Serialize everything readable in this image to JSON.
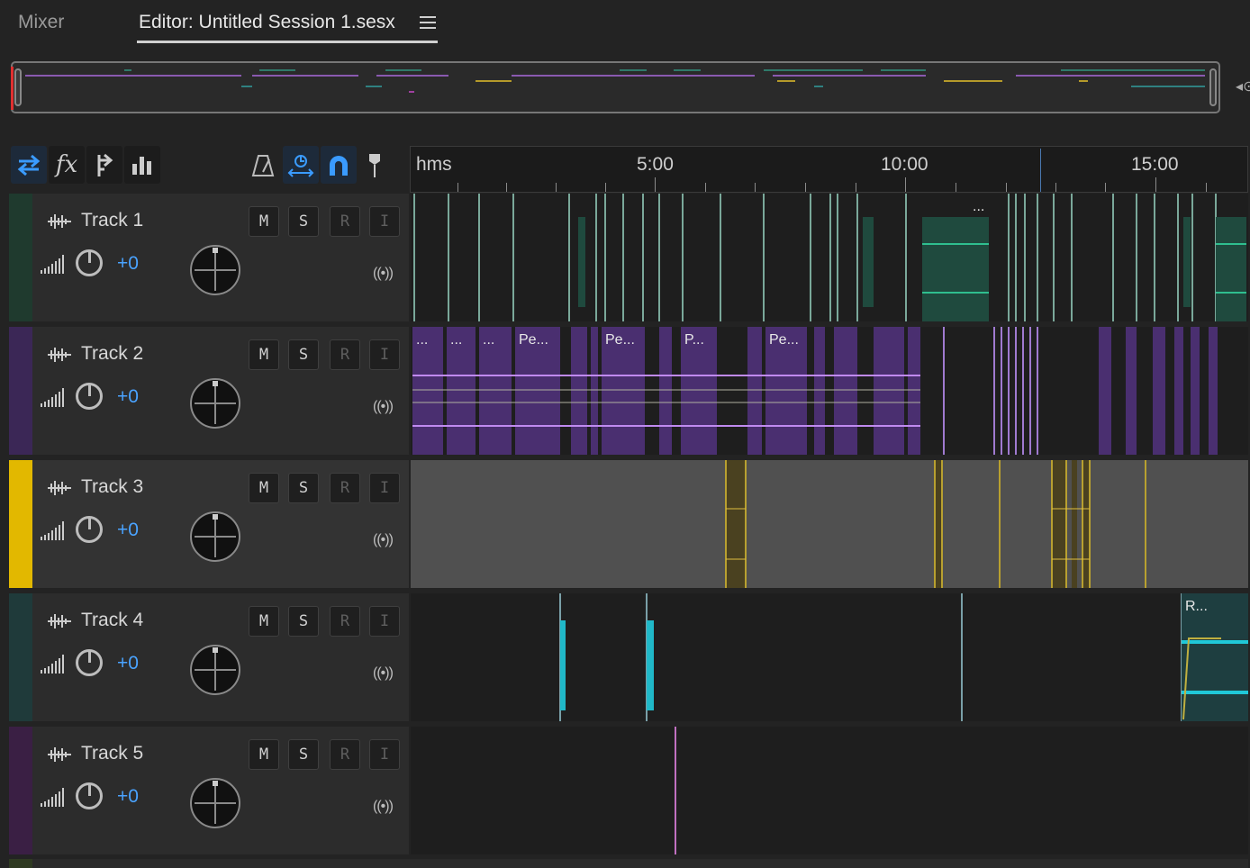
{
  "tabs": {
    "mixer": "Mixer",
    "editor": "Editor: Untitled Session 1.sesx"
  },
  "ruler": {
    "format": "hms",
    "labels": [
      "5:00",
      "10:00",
      "15:00"
    ]
  },
  "colors": {
    "accent": "#4aa3ff",
    "track1": "#1f3a2e",
    "track2": "#3b2756",
    "track3": "#e2b800",
    "track4": "#1f3a3a",
    "track5": "#3a1f44"
  },
  "toolbar": {
    "icons": [
      "switch-icon",
      "fx-icon",
      "sends-icon",
      "eq-icon",
      "metronome-icon",
      "time-select-icon",
      "snap-icon",
      "marker-icon"
    ]
  },
  "tracks": [
    {
      "name": "Track 1",
      "volume": "+0",
      "m": "M",
      "s": "S",
      "r": "R",
      "i": "I",
      "monitor": "((•))"
    },
    {
      "name": "Track 2",
      "volume": "+0",
      "m": "M",
      "s": "S",
      "r": "R",
      "i": "I",
      "monitor": "((•))"
    },
    {
      "name": "Track 3",
      "volume": "+0",
      "m": "M",
      "s": "S",
      "r": "R",
      "i": "I",
      "monitor": "((•))"
    },
    {
      "name": "Track 4",
      "volume": "+0",
      "m": "M",
      "s": "S",
      "r": "R",
      "i": "I",
      "monitor": "((•))"
    },
    {
      "name": "Track 5",
      "volume": "+0",
      "m": "M",
      "s": "S",
      "r": "R",
      "i": "I",
      "monitor": "((•))"
    }
  ],
  "clips": {
    "track1": [
      "..."
    ],
    "track2": [
      "...",
      "...",
      "...",
      "Pe...",
      "Pe...",
      "P...",
      "Pe..."
    ],
    "track4": [
      "R..."
    ]
  }
}
